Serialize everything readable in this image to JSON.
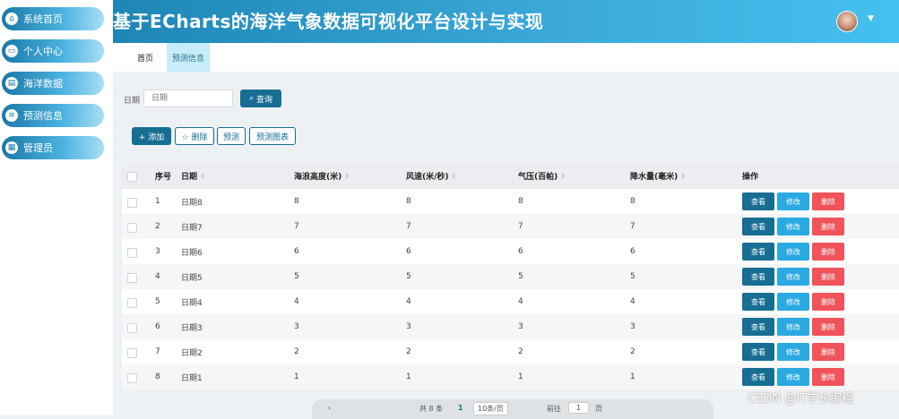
{
  "app": {
    "title": "基于ECharts的海洋气象数据可视化平台设计与实现"
  },
  "sidebar": {
    "items": [
      {
        "label": "系统首页",
        "icon": "home-icon"
      },
      {
        "label": "个人中心",
        "icon": "user-card-icon"
      },
      {
        "label": "海洋数据",
        "icon": "clipboard-icon"
      },
      {
        "label": "预测信息",
        "icon": "sliders-icon"
      },
      {
        "label": "管理员",
        "icon": "grid-icon"
      }
    ]
  },
  "tabs": [
    {
      "label": "首页"
    },
    {
      "label": "预测信息"
    }
  ],
  "search": {
    "label": "日期",
    "placeholder": "日期",
    "button": "查询"
  },
  "toolbar": {
    "add": "+ 添加",
    "delete": "☆ 删除",
    "predict": "预测",
    "chart": "预测图表"
  },
  "table": {
    "headers": {
      "index": "序号",
      "date": "日期",
      "wave": "海浪高度(米)",
      "wind": "风速(米/秒)",
      "pressure": "气压(百帕)",
      "rain": "降水量(毫米)",
      "ops": "操作"
    },
    "actions": {
      "view": "查看",
      "edit": "修改",
      "delete": "删除"
    },
    "rows": [
      {
        "index": "1",
        "date": "日期8",
        "wave": "8",
        "wind": "8",
        "pressure": "8",
        "rain": "8"
      },
      {
        "index": "2",
        "date": "日期7",
        "wave": "7",
        "wind": "7",
        "pressure": "7",
        "rain": "7"
      },
      {
        "index": "3",
        "date": "日期6",
        "wave": "6",
        "wind": "6",
        "pressure": "6",
        "rain": "6"
      },
      {
        "index": "4",
        "date": "日期5",
        "wave": "5",
        "wind": "5",
        "pressure": "5",
        "rain": "5"
      },
      {
        "index": "5",
        "date": "日期4",
        "wave": "4",
        "wind": "4",
        "pressure": "4",
        "rain": "4"
      },
      {
        "index": "6",
        "date": "日期3",
        "wave": "3",
        "wind": "3",
        "pressure": "3",
        "rain": "3"
      },
      {
        "index": "7",
        "date": "日期2",
        "wave": "2",
        "wind": "2",
        "pressure": "2",
        "rain": "2"
      },
      {
        "index": "8",
        "date": "日期1",
        "wave": "1",
        "wind": "1",
        "pressure": "1",
        "rain": "1"
      }
    ]
  },
  "pagination": {
    "total": "共 8 条",
    "current": "1",
    "page_size": "10条/页",
    "goto": "前往",
    "goto_value": "1",
    "page_suffix": "页"
  },
  "watermark": "CSDN @IT学长编程",
  "colors": {
    "primary": "#176e93",
    "edit": "#2aa9e3",
    "delete": "#f0535a",
    "topbar": "#3aa8d8"
  }
}
